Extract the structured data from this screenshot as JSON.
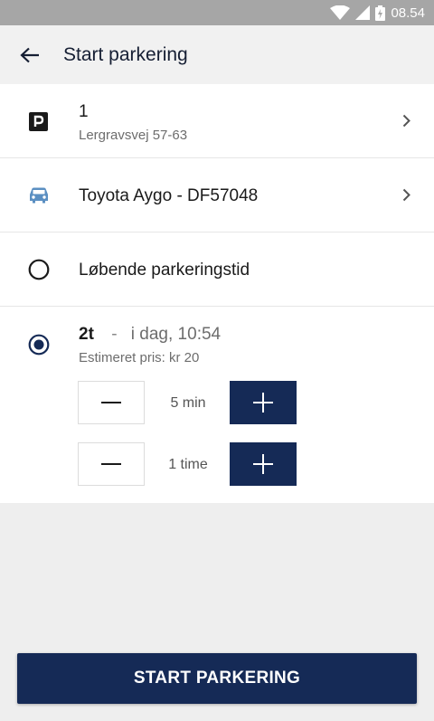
{
  "status_bar": {
    "time": "08.54"
  },
  "header": {
    "title": "Start parkering"
  },
  "zone": {
    "number": "1",
    "address": "Lergravsvej 57-63"
  },
  "vehicle": {
    "label": "Toyota Aygo - DF57048"
  },
  "options": {
    "continuous": {
      "label": "Løbende parkeringstid",
      "selected": false
    },
    "fixed": {
      "duration": "2t",
      "separator": "-",
      "end_time": "i dag, 10:54",
      "price": "Estimeret pris: kr 20",
      "selected": true
    }
  },
  "steppers": [
    {
      "label": "5 min"
    },
    {
      "label": "1 time"
    }
  ],
  "start_button": {
    "label": "START PARKERING"
  },
  "colors": {
    "primary": "#152a56",
    "car_icon": "#5b8fc2"
  },
  "icons": {
    "back": "arrow-left-icon",
    "zone": "parking-icon",
    "vehicle": "car-icon",
    "chevron": "chevron-right-icon",
    "radio_off": "radio-unchecked-icon",
    "radio_on": "radio-checked-icon",
    "minus": "minus-icon",
    "plus": "plus-icon",
    "wifi": "wifi-icon",
    "signal": "signal-icon",
    "battery": "battery-icon"
  }
}
